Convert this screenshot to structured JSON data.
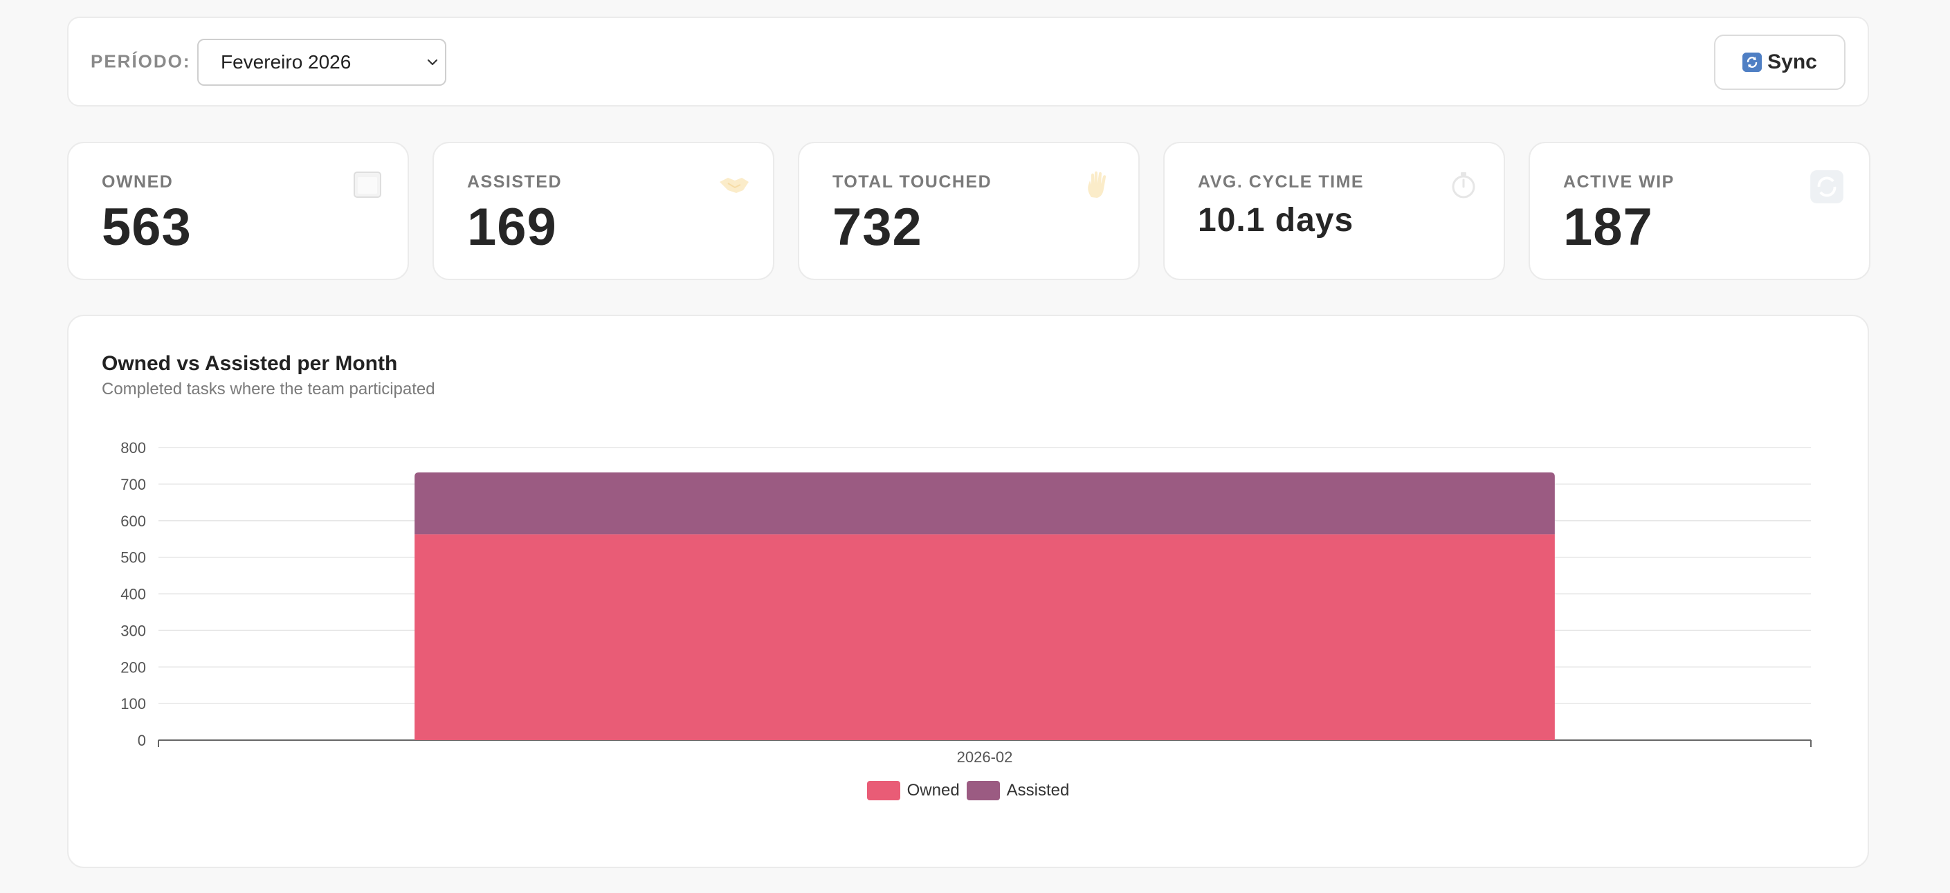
{
  "filter": {
    "period_label": "PERÍODO:",
    "period_value": "Fevereiro 2026",
    "sync_label": "Sync"
  },
  "kpis": [
    {
      "label": "OWNED",
      "value": "563",
      "icon": "clipboard-icon"
    },
    {
      "label": "ASSISTED",
      "value": "169",
      "icon": "handshake-icon"
    },
    {
      "label": "TOTAL TOUCHED",
      "value": "732",
      "icon": "hand-icon"
    },
    {
      "label": "AVG. CYCLE TIME",
      "value": "10.1 days",
      "icon": "stopwatch-icon"
    },
    {
      "label": "ACTIVE WIP",
      "value": "187",
      "icon": "refresh-icon"
    }
  ],
  "colors": {
    "owned": "#e95c76",
    "assisted": "#9b5b82",
    "sync_icon": "#4f7fc4"
  },
  "chart": {
    "title": "Owned vs Assisted per Month",
    "subtitle": "Completed tasks where the team participated"
  },
  "chart_data": {
    "type": "bar",
    "stacked": true,
    "categories": [
      "2026-02"
    ],
    "series": [
      {
        "name": "Owned",
        "values": [
          563
        ]
      },
      {
        "name": "Assisted",
        "values": [
          169
        ]
      }
    ],
    "ylim": [
      0,
      800
    ],
    "yticks": [
      0,
      100,
      200,
      300,
      400,
      500,
      600,
      700,
      800
    ],
    "grid": true,
    "legend": "bottom-center"
  }
}
